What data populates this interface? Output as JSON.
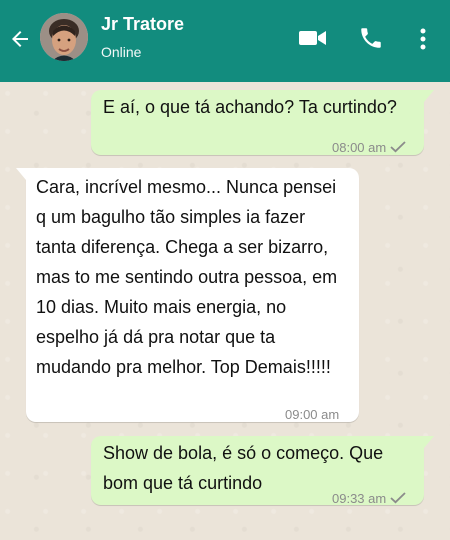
{
  "header": {
    "contact_name": "Jr Tratore",
    "status": "Online",
    "colors": {
      "bar": "#128c7e",
      "outgoing": "#dcf8c6",
      "incoming": "#ffffff"
    }
  },
  "icons": [
    "back-arrow-icon",
    "avatar",
    "video-call-icon",
    "phone-icon",
    "menu-icon"
  ],
  "messages": [
    {
      "from": "me",
      "text": "E aí, o que tá achando? Ta curtindo?",
      "time": "08:00 am",
      "status_icon": "check-icon"
    },
    {
      "from": "contact",
      "text": " Cara, incrível mesmo... Nunca pensei q um bagulho tão simples ia fazer tanta diferença. Chega a ser bizarro, mas to me sentindo outra pessoa, em 10 dias. Muito mais energia, no espelho já dá pra notar que ta mudando pra melhor. Top Demais!!!!!",
      "time": "09:00 am"
    },
    {
      "from": "me",
      "text": "Show de bola, é só o começo. Que bom que tá curtindo",
      "time": "09:33 am",
      "status_icon": "check-icon"
    }
  ]
}
